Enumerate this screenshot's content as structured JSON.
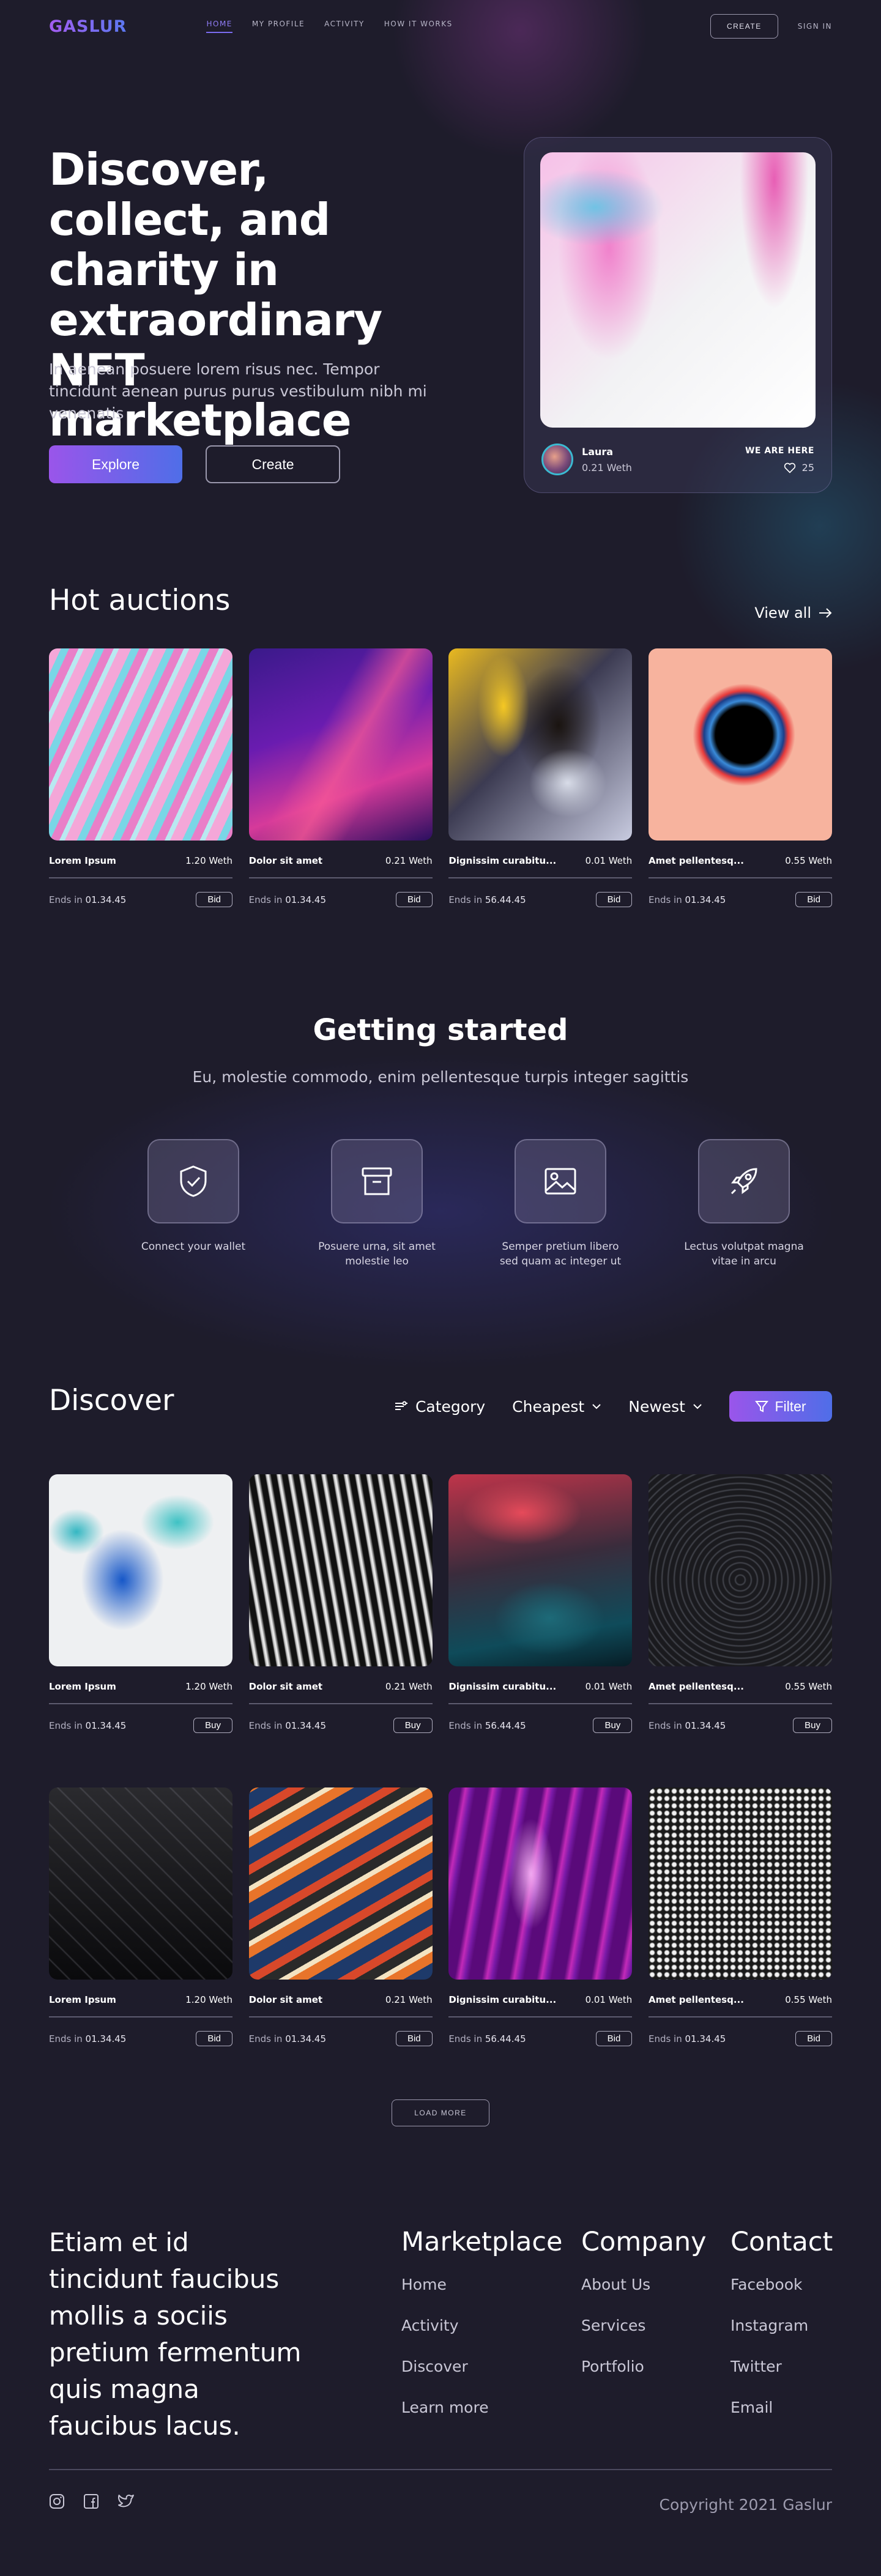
{
  "nav": {
    "logo": "GASLUR",
    "links": [
      "HOME",
      "MY PROFILE",
      "ACTIVITY",
      "HOW IT WORKS"
    ],
    "create": "CREATE",
    "sign_in": "SIGN IN"
  },
  "hero": {
    "title": "Discover, collect, and charity in extraordinary NFT marketplace",
    "subtitle": "In aenean posuere lorem risus nec. Tempor tincidunt aenean purus purus vestibulum nibh mi venenatis",
    "explore": "Explore",
    "create": "Create",
    "card": {
      "name": "Laura",
      "price": "0.21 Weth",
      "tag": "WE ARE HERE",
      "likes": "25"
    }
  },
  "hot_auctions": {
    "title": "Hot auctions",
    "view_all": "View all",
    "items": [
      {
        "name": "Lorem Ipsum",
        "price": "1.20 Weth",
        "ends_label": "Ends in",
        "ends": "01.34.45",
        "button": "Bid"
      },
      {
        "name": "Dolor sit amet",
        "price": "0.21 Weth",
        "ends_label": "Ends in",
        "ends": "01.34.45",
        "button": "Bid"
      },
      {
        "name": "Dignissim curabitu...",
        "price": "0.01 Weth",
        "ends_label": "Ends in",
        "ends": "56.44.45",
        "button": "Bid"
      },
      {
        "name": "Amet pellentesq...",
        "price": "0.55 Weth",
        "ends_label": "Ends in",
        "ends": "01.34.45",
        "button": "Bid"
      }
    ]
  },
  "getting_started": {
    "title": "Getting started",
    "subtitle": "Eu, molestie commodo, enim pellentesque turpis integer sagittis",
    "steps": [
      {
        "icon": "shield-check-icon",
        "label": "Connect your wallet"
      },
      {
        "icon": "archive-box-icon",
        "label": "Posuere urna, sit amet molestie leo"
      },
      {
        "icon": "image-icon",
        "label": "Semper pretium libero sed quam ac integer ut"
      },
      {
        "icon": "rocket-icon",
        "label": "Lectus volutpat magna vitae in arcu"
      }
    ]
  },
  "discover": {
    "title": "Discover",
    "category": "Category",
    "sort": "Cheapest",
    "order": "Newest",
    "filter": "Filter",
    "row1": [
      {
        "name": "Lorem Ipsum",
        "price": "1.20 Weth",
        "ends_label": "Ends in",
        "ends": "01.34.45",
        "button": "Buy"
      },
      {
        "name": "Dolor sit amet",
        "price": "0.21 Weth",
        "ends_label": "Ends in",
        "ends": "01.34.45",
        "button": "Buy"
      },
      {
        "name": "Dignissim curabitu...",
        "price": "0.01 Weth",
        "ends_label": "Ends in",
        "ends": "56.44.45",
        "button": "Buy"
      },
      {
        "name": "Amet pellentesq...",
        "price": "0.55 Weth",
        "ends_label": "Ends in",
        "ends": "01.34.45",
        "button": "Buy"
      }
    ],
    "row2": [
      {
        "name": "Lorem Ipsum",
        "price": "1.20 Weth",
        "ends_label": "Ends in",
        "ends": "01.34.45",
        "button": "Bid"
      },
      {
        "name": "Dolor sit amet",
        "price": "0.21 Weth",
        "ends_label": "Ends in",
        "ends": "01.34.45",
        "button": "Bid"
      },
      {
        "name": "Dignissim curabitu...",
        "price": "0.01 Weth",
        "ends_label": "Ends in",
        "ends": "56.44.45",
        "button": "Bid"
      },
      {
        "name": "Amet pellentesq...",
        "price": "0.55 Weth",
        "ends_label": "Ends in",
        "ends": "01.34.45",
        "button": "Bid"
      }
    ],
    "load_more": "LOAD MORE"
  },
  "footer": {
    "tagline": "Etiam et id tincidunt faucibus mollis a sociis pretium fermentum quis magna faucibus lacus.",
    "marketplace": {
      "title": "Marketplace",
      "links": [
        "Home",
        "Activity",
        "Discover",
        "Learn more"
      ]
    },
    "company": {
      "title": "Company",
      "links": [
        "About Us",
        "Services",
        "Portfolio"
      ]
    },
    "contact": {
      "title": "Contact",
      "links": [
        "Facebook",
        "Instagram",
        "Twitter",
        "Email"
      ]
    },
    "copyright": "Copyright 2021 Gaslur"
  },
  "colors": {
    "background": "#1e1c2b",
    "accent_start": "#9a55ea",
    "accent_end": "#4f6ee8",
    "nav_active": "#8f7cf5"
  }
}
